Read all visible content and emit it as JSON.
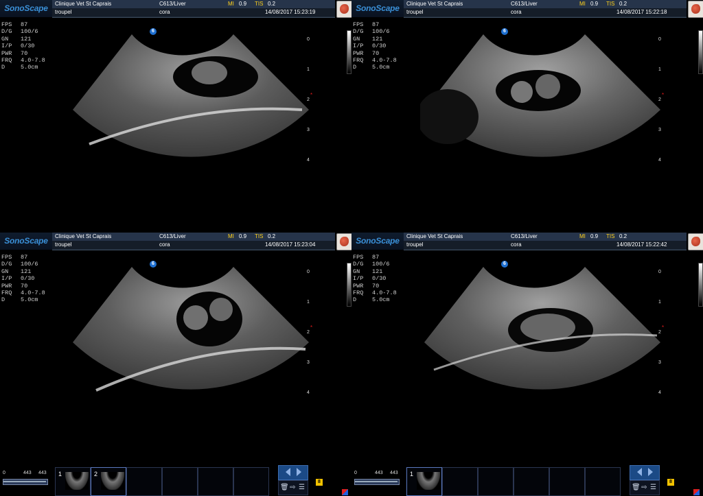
{
  "panels": [
    {
      "id": "tl",
      "logo": "SonoScape",
      "clinic": "Clinique Vet St Caprais",
      "probe": "C613/Liver",
      "mi_label": "MI",
      "mi_value": "0.9",
      "tis_label": "TIS",
      "tis_value": "0.2",
      "patient": "troupel",
      "animal": "cora",
      "datetime": "14/08/2017 15:23:19"
    },
    {
      "id": "tr",
      "logo": "SonoScape",
      "clinic": "Clinique Vet St Caprais",
      "probe": "C613/Liver",
      "mi_label": "MI",
      "mi_value": "0.9",
      "tis_label": "TIS",
      "tis_value": "0.2",
      "patient": "troupel",
      "animal": "cora",
      "datetime": "14/08/2017 15:22:18"
    },
    {
      "id": "bl",
      "logo": "SonoScape",
      "clinic": "Clinique Vet St Caprais",
      "probe": "C613/Liver",
      "mi_label": "MI",
      "mi_value": "0.9",
      "tis_label": "TIS",
      "tis_value": "0.2",
      "patient": "troupel",
      "animal": "cora",
      "datetime": "14/08/2017 15:23:04"
    },
    {
      "id": "br",
      "logo": "SonoScape",
      "clinic": "Clinique Vet St Caprais",
      "probe": "C613/Liver",
      "mi_label": "MI",
      "mi_value": "0.9",
      "tis_label": "TIS",
      "tis_value": "0.2",
      "patient": "troupel",
      "animal": "cora",
      "datetime": "14/08/2017 15:22:42"
    }
  ],
  "params": [
    {
      "k": "FPS",
      "v": "87"
    },
    {
      "k": "D/G",
      "v": "100/6"
    },
    {
      "k": "GN",
      "v": "121"
    },
    {
      "k": "I/P",
      "v": "0/30"
    },
    {
      "k": "PWR",
      "v": "70"
    },
    {
      "k": "FRQ",
      "v": "4.0-7.8"
    },
    {
      "k": "D",
      "v": "5.0cm"
    }
  ],
  "depth_ticks": [
    "0",
    "1",
    "2",
    "3",
    "4"
  ],
  "focus_marker": "*",
  "probe_badge": "6",
  "cine": {
    "start": "0",
    "pos": "443",
    "end": "443"
  },
  "cine_right": {
    "start": "0",
    "pos": "443",
    "end": "443"
  },
  "thumbs_left": [
    "1",
    "2"
  ],
  "thumbs_right": [
    "1"
  ],
  "page_counter": "8",
  "icons": {
    "prev": "chevron-left-icon",
    "next": "chevron-right-icon",
    "delete": "trash-icon",
    "send": "send-icon",
    "report": "report-icon",
    "organ": "liver-organ-icon"
  }
}
